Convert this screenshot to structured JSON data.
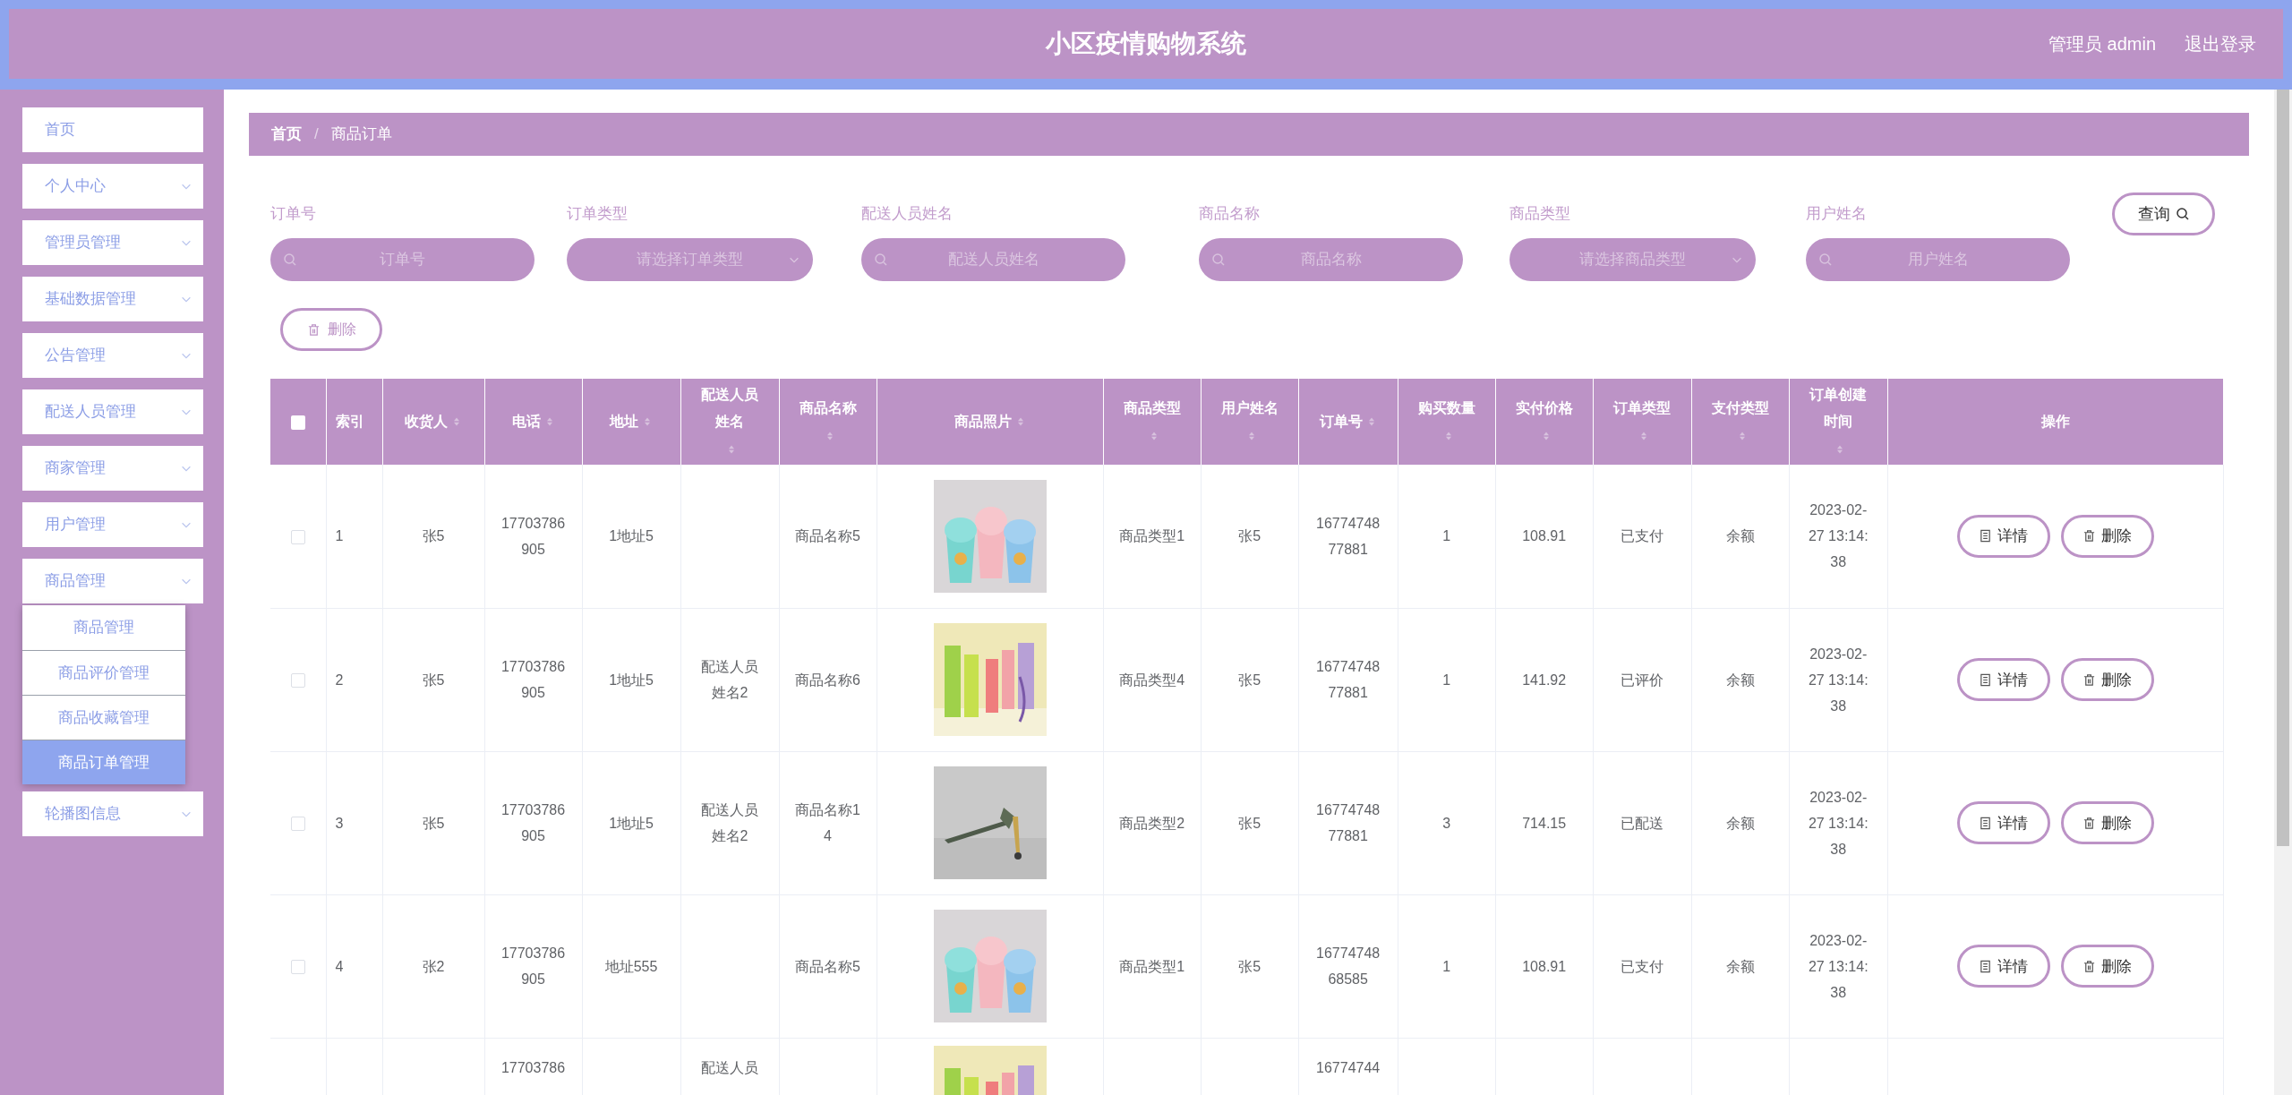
{
  "header": {
    "title": "小区疫情购物系统",
    "user_label": "管理员 admin",
    "logout": "退出登录"
  },
  "sidebar": {
    "items": [
      {
        "label": "首页",
        "kind": "link"
      },
      {
        "label": "个人中心",
        "kind": "menu"
      },
      {
        "label": "管理员管理",
        "kind": "menu"
      },
      {
        "label": "基础数据管理",
        "kind": "menu"
      },
      {
        "label": "公告管理",
        "kind": "menu"
      },
      {
        "label": "配送人员管理",
        "kind": "menu"
      },
      {
        "label": "商家管理",
        "kind": "menu"
      },
      {
        "label": "用户管理",
        "kind": "menu"
      },
      {
        "label": "商品管理",
        "kind": "menu",
        "children": [
          {
            "label": "商品管理",
            "selected": false
          },
          {
            "label": "商品评价管理",
            "selected": false
          },
          {
            "label": "商品收藏管理",
            "selected": false
          },
          {
            "label": "商品订单管理",
            "selected": true
          }
        ]
      },
      {
        "label": "轮播图信息",
        "kind": "menu"
      }
    ]
  },
  "breadcrumb": {
    "items": [
      "首页",
      "商品订单"
    ],
    "separator": "/"
  },
  "search": {
    "fields": [
      {
        "label": "订单号",
        "placeholder": "订单号",
        "kind": "text"
      },
      {
        "label": "订单类型",
        "placeholder": "请选择订单类型",
        "kind": "select"
      },
      {
        "label": "配送人员姓名",
        "placeholder": "配送人员姓名",
        "kind": "text"
      },
      {
        "label": "商品名称",
        "placeholder": "商品名称",
        "kind": "text"
      },
      {
        "label": "商品类型",
        "placeholder": "请选择商品类型",
        "kind": "select"
      },
      {
        "label": "用户姓名",
        "placeholder": "用户姓名",
        "kind": "text"
      }
    ],
    "query_button": "查询"
  },
  "delete_button": "删除",
  "table": {
    "select_all": {
      "checked": false
    },
    "columns": [
      {
        "label": "索引",
        "sortable": false
      },
      {
        "label": "收货人",
        "sortable": true
      },
      {
        "label": "电话",
        "sortable": true
      },
      {
        "label": "地址",
        "sortable": true
      },
      {
        "label": "配送人员姓名",
        "sortable": true
      },
      {
        "label": "商品名称",
        "sortable": true
      },
      {
        "label": "商品照片",
        "sortable": true
      },
      {
        "label": "商品类型",
        "sortable": true
      },
      {
        "label": "用户姓名",
        "sortable": true
      },
      {
        "label": "订单号",
        "sortable": true
      },
      {
        "label": "购买数量",
        "sortable": true
      },
      {
        "label": "实付价格",
        "sortable": true
      },
      {
        "label": "订单类型",
        "sortable": true
      },
      {
        "label": "支付类型",
        "sortable": true
      },
      {
        "label": "订单创建时间",
        "sortable": true
      },
      {
        "label": "操作",
        "sortable": false
      }
    ],
    "rows": [
      {
        "checked": false,
        "index": "1",
        "receiver": "张5",
        "phone": "17703786905",
        "address": "1地址5",
        "product_name": "商品名称5",
        "product_type": "商品类型1",
        "user_name": "张5",
        "order_no": "1677474877881",
        "quantity": "1",
        "paid_price": "108.91",
        "order_type": "已支付",
        "pay_type": "余额",
        "created_at": "2023-02-27 13:14:38",
        "actions": [
          "详情",
          "删除"
        ]
      },
      {
        "checked": false,
        "index": "2",
        "receiver": "张5",
        "phone": "17703786905",
        "address": "1地址5",
        "courier": "配送人员姓名2",
        "product_name": "商品名称6",
        "product_type": "商品类型4",
        "user_name": "张5",
        "order_no": "1677474877881",
        "quantity": "1",
        "paid_price": "141.92",
        "order_type": "已评价",
        "pay_type": "余额",
        "created_at": "2023-02-27 13:14:38",
        "actions": [
          "详情",
          "删除"
        ]
      },
      {
        "checked": false,
        "index": "3",
        "receiver": "张5",
        "phone": "17703786905",
        "address": "1地址5",
        "courier": "配送人员姓名2",
        "product_name": "商品名称14",
        "product_type": "商品类型2",
        "user_name": "张5",
        "order_no": "1677474877881",
        "quantity": "3",
        "paid_price": "714.15",
        "order_type": "已配送",
        "pay_type": "余额",
        "created_at": "2023-02-27 13:14:38",
        "actions": [
          "详情",
          "删除"
        ]
      },
      {
        "checked": false,
        "index": "4",
        "receiver": "张2",
        "phone": "17703786905",
        "address": "地址555",
        "product_name": "商品名称5",
        "product_type": "商品类型1",
        "user_name": "张5",
        "order_no": "1677474868585",
        "quantity": "1",
        "paid_price": "108.91",
        "order_type": "已支付",
        "pay_type": "余额",
        "created_at": "2023-02-27 13:14:38",
        "actions": [
          "详情",
          "删除"
        ]
      },
      {
        "phone": "17703786",
        "courier": "配送人员",
        "order_no": "16774744"
      }
    ]
  }
}
